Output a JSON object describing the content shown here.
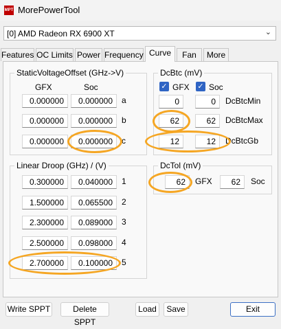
{
  "window": {
    "title": "MorePowerTool",
    "icon_text": "MPT"
  },
  "device": {
    "selected": "[0] AMD Radeon RX 6900 XT"
  },
  "tabs": [
    {
      "label": "Features"
    },
    {
      "label": "OC Limits"
    },
    {
      "label": "Power"
    },
    {
      "label": "Frequency"
    },
    {
      "label": "Curve"
    },
    {
      "label": "Fan"
    },
    {
      "label": "More"
    }
  ],
  "active_tab": "Curve",
  "static_voltage_offset": {
    "title": "StaticVoltageOffset (GHz->V)",
    "col_gfx": "GFX",
    "col_soc": "Soc",
    "rows": [
      {
        "label": "a",
        "gfx": "0.000000",
        "soc": "0.000000"
      },
      {
        "label": "b",
        "gfx": "0.000000",
        "soc": "0.000000"
      },
      {
        "label": "c",
        "gfx": "0.000000",
        "soc": "0.000000"
      }
    ]
  },
  "linear_droop": {
    "title": "Linear Droop (GHz) / (V)",
    "rows": [
      {
        "label": "1",
        "ghz": "0.300000",
        "v": "0.040000"
      },
      {
        "label": "2",
        "ghz": "1.500000",
        "v": "0.065500"
      },
      {
        "label": "3",
        "ghz": "2.300000",
        "v": "0.089000"
      },
      {
        "label": "4",
        "ghz": "2.500000",
        "v": "0.098000"
      },
      {
        "label": "5",
        "ghz": "2.700000",
        "v": "0.100000"
      }
    ]
  },
  "dcbtc": {
    "title": "DcBtc (mV)",
    "gfx_label": "GFX",
    "gfx_checked": true,
    "soc_label": "Soc",
    "soc_checked": true,
    "rows": [
      {
        "label": "DcBtcMin",
        "gfx": "0",
        "soc": "0"
      },
      {
        "label": "DcBtcMax",
        "gfx": "62",
        "soc": "62"
      },
      {
        "label": "DcBtcGb",
        "gfx": "12",
        "soc": "12"
      }
    ]
  },
  "dctol": {
    "title": "DcTol (mV)",
    "gfx_label": "GFX",
    "gfx": "62",
    "soc_label": "Soc",
    "soc": "62"
  },
  "buttons": {
    "write_sppt": "Write SPPT",
    "delete_sppt": "Delete SPPT",
    "load": "Load",
    "save": "Save",
    "exit": "Exit"
  },
  "highlight_color": "#f5a623",
  "accent_color": "#2f64c4"
}
